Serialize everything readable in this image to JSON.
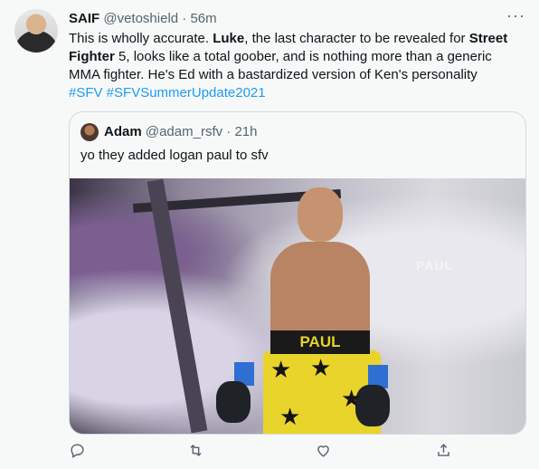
{
  "tweet": {
    "name": "SAIF",
    "handle": "@vetoshield",
    "dot": "·",
    "time": "56m",
    "text": {
      "p1": "This is wholly accurate. ",
      "b1": "Luke",
      "p2": ", the last character to be revealed for ",
      "b2": "Street Fighter",
      "p3": " 5, looks like a total goober, and is nothing more than a generic MMA fighter. He's Ed with a bastardized version of Ken's personality",
      "hashtags": "#SFV #SFVSummerUpdate2021"
    },
    "more_icon": "more-horizontal-icon"
  },
  "quote": {
    "name": "Adam",
    "handle": "@adam_rsfv",
    "dot": "·",
    "time": "21h",
    "text": "yo they added logan paul to sfv",
    "photo": {
      "waistband_text": "PAUL",
      "sign_text": "PAUL"
    }
  },
  "actions": [
    {
      "name": "reply-icon"
    },
    {
      "name": "retweet-icon"
    },
    {
      "name": "like-icon"
    },
    {
      "name": "share-icon"
    }
  ],
  "colors": {
    "background": "#f7f9f9",
    "text": "#0f1419",
    "secondary": "#536471",
    "link": "#1d9bf0",
    "border": "#cfd9de"
  }
}
